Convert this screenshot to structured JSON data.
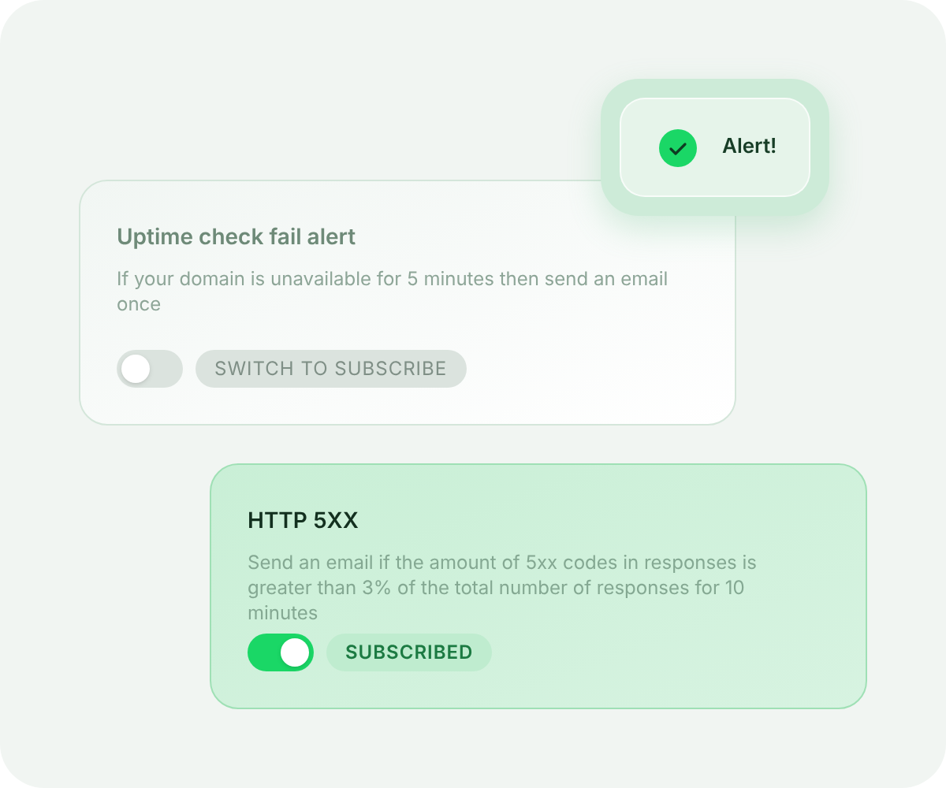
{
  "toast": {
    "label": "Alert!"
  },
  "cards": [
    {
      "title": "Uptime check fail alert",
      "description": "If your domain is unavailable for 5 minutes then send an email once",
      "on": false,
      "status": "SWITCH TO SUBSCRIBE"
    },
    {
      "title": "HTTP 5XX",
      "description": "Send an email if the amount of 5xx codes in responses is greater than 3% of the total number of responses for 10 minutes",
      "on": true,
      "status": "SUBSCRIBED"
    }
  ]
}
